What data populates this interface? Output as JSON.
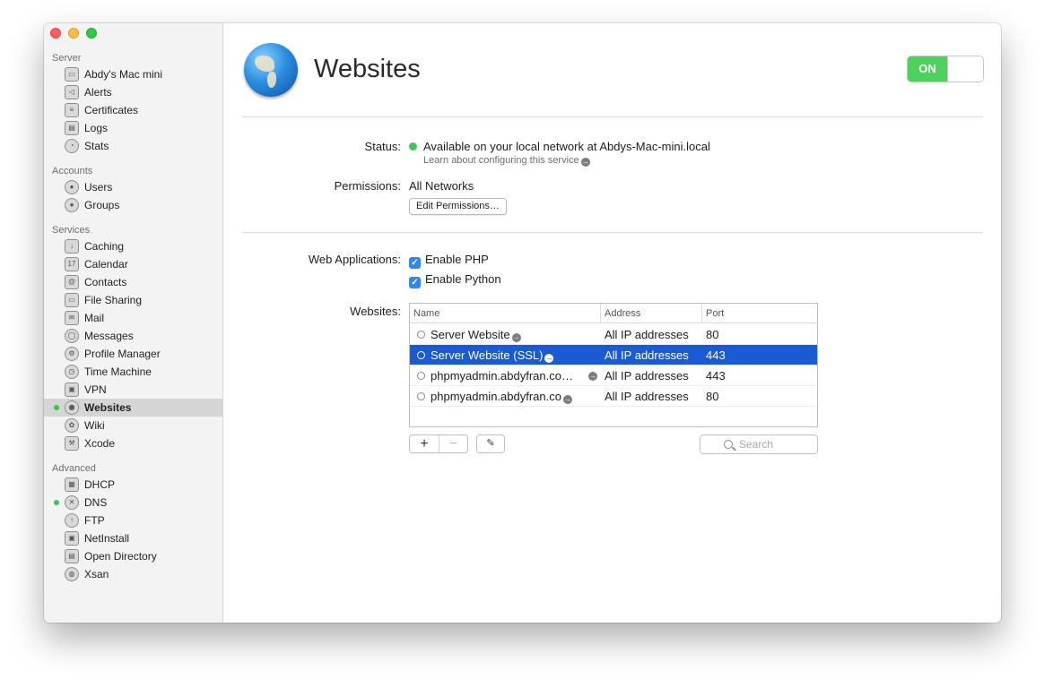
{
  "sidebar": {
    "sections": [
      {
        "label": "Server",
        "items": [
          {
            "label": "Abdy's Mac mini",
            "icon": "mac-mini-icon",
            "glyph": "▭"
          },
          {
            "label": "Alerts",
            "icon": "megaphone-icon",
            "glyph": "◁"
          },
          {
            "label": "Certificates",
            "icon": "certificate-icon",
            "glyph": "≡"
          },
          {
            "label": "Logs",
            "icon": "log-icon",
            "glyph": "▤"
          },
          {
            "label": "Stats",
            "icon": "stats-icon",
            "glyph": "◔"
          }
        ]
      },
      {
        "label": "Accounts",
        "items": [
          {
            "label": "Users",
            "icon": "user-icon",
            "glyph": "●"
          },
          {
            "label": "Groups",
            "icon": "group-icon",
            "glyph": "●"
          }
        ]
      },
      {
        "label": "Services",
        "items": [
          {
            "label": "Caching",
            "icon": "caching-icon",
            "glyph": "↓"
          },
          {
            "label": "Calendar",
            "icon": "calendar-icon",
            "glyph": "17"
          },
          {
            "label": "Contacts",
            "icon": "contacts-icon",
            "glyph": "@"
          },
          {
            "label": "File Sharing",
            "icon": "folder-icon",
            "glyph": "▭"
          },
          {
            "label": "Mail",
            "icon": "mail-icon",
            "glyph": "✉"
          },
          {
            "label": "Messages",
            "icon": "messages-icon",
            "glyph": "◯"
          },
          {
            "label": "Profile Manager",
            "icon": "profile-manager-icon",
            "glyph": "⚙"
          },
          {
            "label": "Time Machine",
            "icon": "time-machine-icon",
            "glyph": "◷"
          },
          {
            "label": "VPN",
            "icon": "vpn-lock-icon",
            "glyph": "▣"
          },
          {
            "label": "Websites",
            "icon": "globe-icon",
            "glyph": "◉"
          },
          {
            "label": "Wiki",
            "icon": "wiki-icon",
            "glyph": "✿"
          },
          {
            "label": "Xcode",
            "icon": "xcode-icon",
            "glyph": "⚒"
          }
        ]
      },
      {
        "label": "Advanced",
        "items": [
          {
            "label": "DHCP",
            "icon": "dhcp-icon",
            "glyph": "▦"
          },
          {
            "label": "DNS",
            "icon": "dns-icon",
            "glyph": "✕"
          },
          {
            "label": "FTP",
            "icon": "ftp-icon",
            "glyph": "↑"
          },
          {
            "label": "NetInstall",
            "icon": "netinstall-icon",
            "glyph": "▣"
          },
          {
            "label": "Open Directory",
            "icon": "open-directory-icon",
            "glyph": "▤"
          },
          {
            "label": "Xsan",
            "icon": "xsan-icon",
            "glyph": "◍"
          }
        ]
      }
    ]
  },
  "header": {
    "title": "Websites",
    "toggle_label": "ON"
  },
  "status": {
    "label": "Status:",
    "value": "Available on your local network at Abdys-Mac-mini.local",
    "link": "Learn about configuring this service"
  },
  "permissions": {
    "label": "Permissions:",
    "value": "All Networks",
    "button": "Edit Permissions…"
  },
  "web_apps": {
    "label": "Web Applications:",
    "php": "Enable PHP",
    "python": "Enable Python"
  },
  "websites": {
    "label": "Websites:",
    "columns": [
      "Name",
      "Address",
      "Port"
    ],
    "rows": [
      {
        "name": "Server Website",
        "address": "All IP addresses",
        "port": "80"
      },
      {
        "name": "Server Website (SSL)",
        "address": "All IP addresses",
        "port": "443"
      },
      {
        "name": "phpmyadmin.abdyfran.co…",
        "address": "All IP addresses",
        "port": "443"
      },
      {
        "name": "phpmyadmin.abdyfran.co",
        "address": "All IP addresses",
        "port": "80"
      }
    ],
    "search_placeholder": "Search"
  },
  "colors": {
    "selection": "#1a5bd4",
    "toggle_on": "#4dd25e",
    "status_dot": "#3ec45a"
  }
}
